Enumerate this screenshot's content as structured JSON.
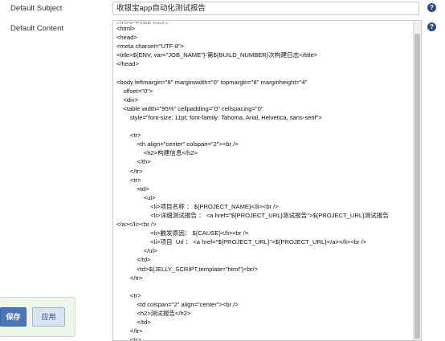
{
  "subject": {
    "label": "Default Subject",
    "value": "收银宝app自动化测试报告"
  },
  "content": {
    "label": "Default Content",
    "top_cut_text": "<!DOCTYPE html>",
    "lines": [
      "<html>",
      "<head>",
      "<meta charset=\"UTF-8\">",
      "<title>${ENV, var=\"JOB_NAME\"}-第${BUILD_NUMBER}次构建日志</title>",
      "</head>",
      "",
      "<body leftmargin=\"8\" marginwidth=\"0\" topmargin=\"8\" marginheight=\"4\"",
      "    offset=\"0\">",
      "    <div>",
      "    <table width=\"95%\" cellpadding=\"0\" cellspacing=\"0\"",
      "        style=\"font-size: 11pt; font-family: Tahoma, Arial, Helvetica, sans-serif\">",
      "",
      "        <tr>",
      "            <th align=\"center\" colspan=\"2\"><br />",
      "                <h2>构建信息</h2>",
      "            </th>",
      "        </tr>",
      "        <tr>",
      "            <td>",
      "                <ul>",
      "                    <li>项目名称 ： ${PROJECT_NAME}</li><br />",
      "                    <li>详细测试报告 ： <a href=\"${PROJECT_URL}测试报告\">${PROJECT_URL}测试报告",
      "</a></li><br />",
      "                    <li>触发原因： ${CAUSE}</li><br />",
      "                    <li>项目  Url ： <a href=\"${PROJECT_URL}\">${PROJECT_URL}</a></li><br />",
      "                </ul>",
      "            </td>",
      "            <td>${JELLY_SCRIPT,template=\"html\"}<br/>",
      "        </tr>",
      "",
      "        <tr>",
      "            <td colspan=\"2\" align=\"center\"><br />",
      "            <h2>测试报告</h2>",
      "            </td>",
      "        </tr>",
      "        <tr>"
    ]
  },
  "buttons": {
    "save": "保存",
    "apply": "应用"
  },
  "help_icon_glyph": "?",
  "colors": {
    "primary_button": "#4b75b9",
    "secondary_button": "#d9e3f1",
    "button_bar_bg": "#eef5e9",
    "help_icon": "#2a4d87"
  }
}
